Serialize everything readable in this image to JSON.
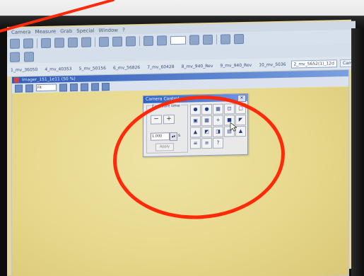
{
  "menu": [
    "Camera",
    "Measure",
    "Grab",
    "Special",
    "Window",
    "?"
  ],
  "tabs": [
    "1_mv_36050",
    "4_mv_40353",
    "5_mv_50156",
    "6_mv_56826",
    "7_mv_60428",
    "8_mv_940_Rev",
    "9_mv_940_Rev",
    "10_mv_5036",
    "2_mv_5652(1)_12d",
    "Cam_06L081"
  ],
  "image_window": {
    "title": "Imager_151_1e11 (50 %)",
    "zoom_text": "Fit"
  },
  "camera_control": {
    "title": "Camera Control",
    "close": "✕",
    "exposure_label": "Exposure time",
    "minus": "−",
    "plus": "+",
    "exposure_value": "1.000",
    "unit": "s",
    "apply_label": "Apply",
    "grid_buttons": [
      "●",
      "●",
      "▦",
      "⊡",
      "▢",
      "▣",
      "▦",
      "+",
      "■",
      "◤",
      "▲",
      "◩",
      "◨",
      "▤",
      "▲",
      "≡",
      "≡",
      "?"
    ]
  },
  "colors": {
    "annotation": "#ff2a0a",
    "title_bar": "#2e61c2",
    "canvas": "#e7d88c"
  }
}
